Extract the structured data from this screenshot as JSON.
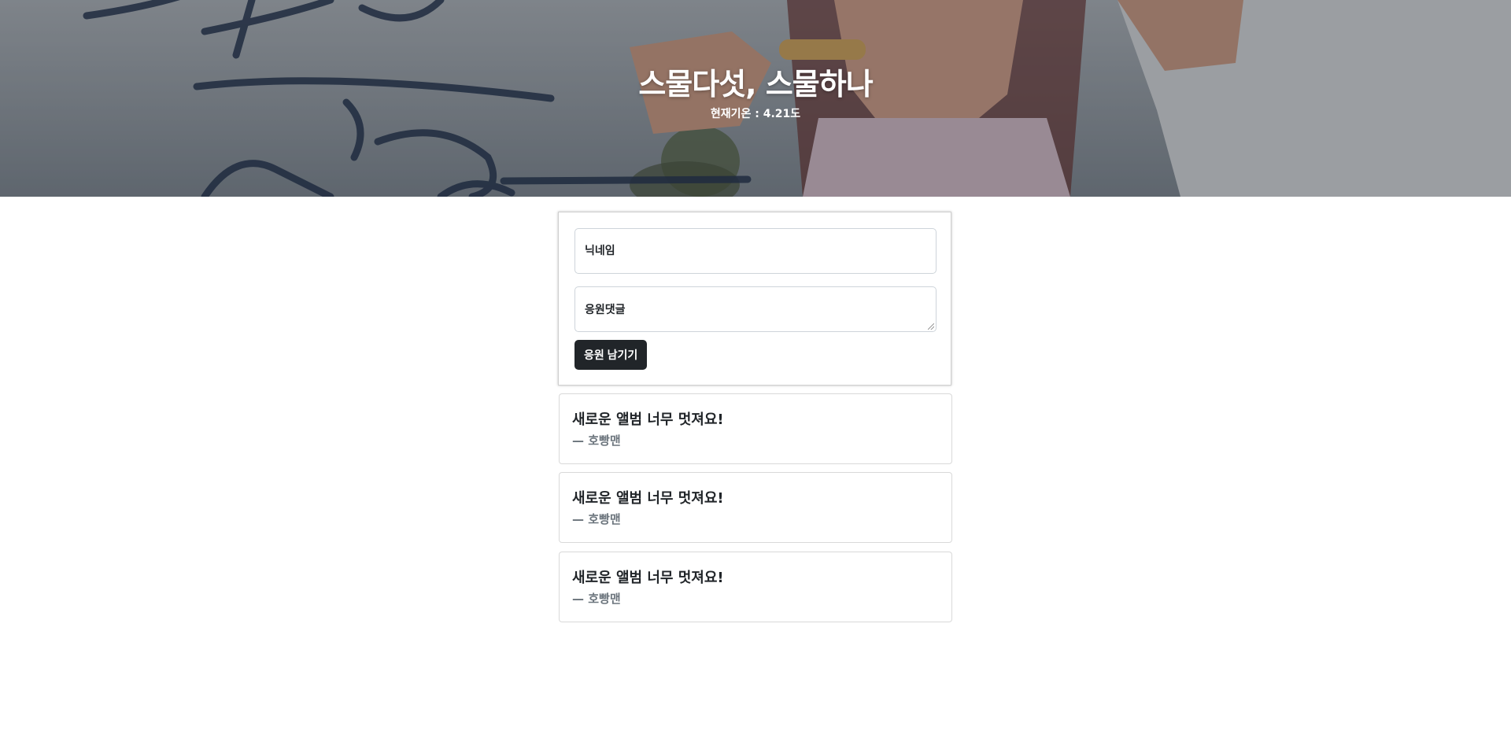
{
  "banner": {
    "title": "스물다섯, 스물하나",
    "temperature": "현재기온 : 4.21도"
  },
  "form": {
    "nickname_placeholder": "닉네임",
    "comment_placeholder": "응원댓글",
    "submit_label": "응원 남기기"
  },
  "comments": [
    {
      "text": "새로운 앨범 너무 멋져요!",
      "author": "— 호빵맨"
    },
    {
      "text": "새로운 앨범 너무 멋져요!",
      "author": "— 호빵맨"
    },
    {
      "text": "새로운 앨범 너무 멋져요!",
      "author": "— 호빵맨"
    }
  ],
  "colors": {
    "button_bg": "#212529",
    "author_text": "#6c757d",
    "brush_text": "#2a3a55"
  }
}
